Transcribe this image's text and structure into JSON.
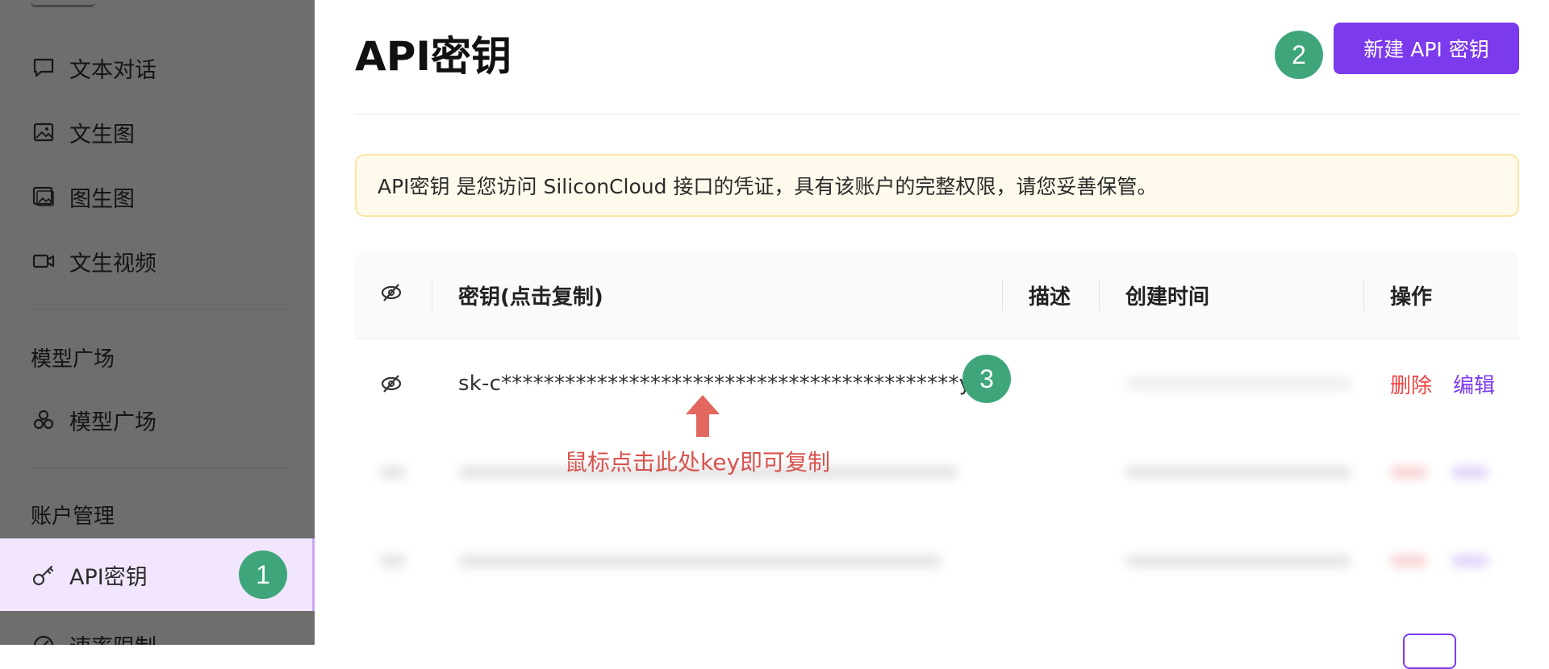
{
  "sidebar": {
    "items": [
      {
        "label": "文本对话",
        "icon": "chat-bubble-icon"
      },
      {
        "label": "文生图",
        "icon": "image-icon"
      },
      {
        "label": "图生图",
        "icon": "images-icon"
      },
      {
        "label": "文生视频",
        "icon": "video-icon"
      }
    ],
    "section_models": "模型广场",
    "models_item": {
      "label": "模型广场",
      "icon": "cubes-icon"
    },
    "section_account": "账户管理",
    "active_item": {
      "label": "API密钥",
      "icon": "key-icon"
    },
    "partial_item": {
      "label": "速率限制",
      "icon": "gauge-icon"
    }
  },
  "main": {
    "title": "API密钥",
    "new_button": "新建 API 密钥",
    "notice": "API密钥 是您访问 SiliconCloud 接口的凭证，具有该账户的完整权限，请您妥善保管。",
    "table": {
      "headers": {
        "key": "密钥(点击复制)",
        "desc": "描述",
        "created": "创建时间",
        "actions": "操作"
      },
      "rows": [
        {
          "key": "sk-c*******************************************yfpy",
          "delete": "删除",
          "edit": "编辑"
        }
      ]
    }
  },
  "annotations": {
    "badge1": "1",
    "badge2": "2",
    "badge3": "3",
    "hint": "鼠标点击此处key即可复制"
  },
  "colors": {
    "accent": "#7c3aed",
    "badge": "#3fa67c",
    "danger": "#ef4444",
    "hint": "#d9534f",
    "notice_bg": "#fffaeb"
  }
}
